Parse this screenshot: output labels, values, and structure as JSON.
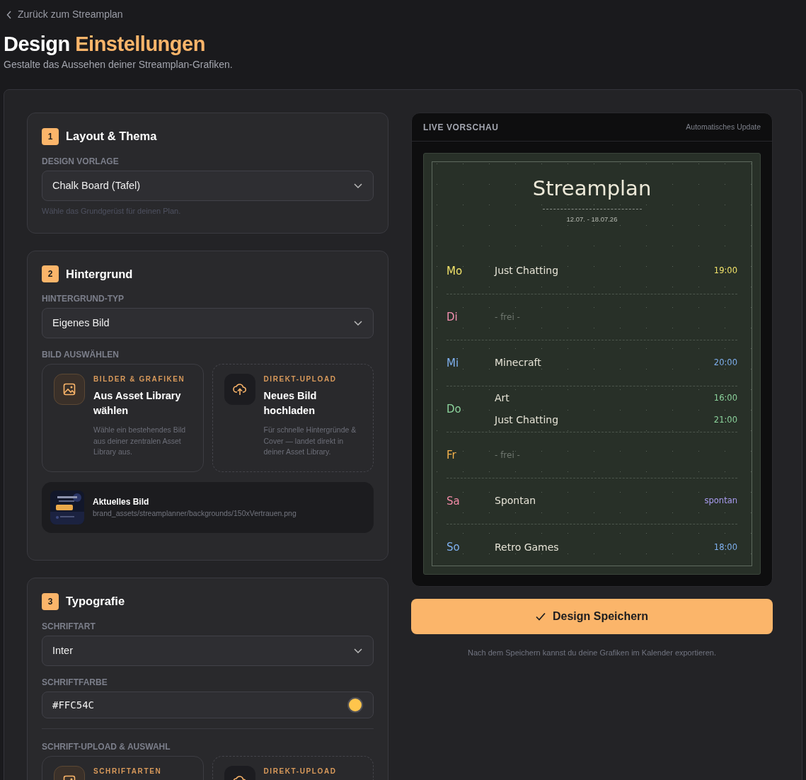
{
  "back_link": "Zurück zum Streamplan",
  "title": {
    "main": "Design",
    "accent": "Einstellungen"
  },
  "subtitle": "Gestalte das Aussehen deiner Streamplan-Grafiken.",
  "sections": [
    {
      "number": "1",
      "title": "Layout & Thema",
      "fields": [
        {
          "kind": "select",
          "label": "DESIGN VORLAGE",
          "value": "Chalk Board (Tafel)",
          "hint": "Wähle das Grundgerüst für deinen Plan."
        }
      ]
    },
    {
      "number": "2",
      "title": "Hintergrund",
      "fields": [
        {
          "kind": "select",
          "label": "HINTERGRUND-TYP",
          "value": "Eigenes Bild"
        },
        {
          "kind": "options",
          "label": "BILD AUSWÄHLEN",
          "options": [
            {
              "kind": "library",
              "eyebrow": "BILDER & GRAFIKEN",
              "title": "Aus Asset Library wählen",
              "text": "Wähle ein bestehendes Bild aus deiner zentralen Asset Library aus."
            },
            {
              "kind": "upload",
              "eyebrow": "DIREKT-UPLOAD",
              "title": "Neues Bild hochladen",
              "text": "Für schnelle Hintergründe & Cover — landet direkt in deiner Asset Library."
            }
          ]
        },
        {
          "kind": "current",
          "title": "Aktuelles Bild",
          "path": "brand_assets/streamplanner/backgrounds/150xVertrauen.png"
        }
      ]
    },
    {
      "number": "3",
      "title": "Typografie",
      "fields": [
        {
          "kind": "select",
          "label": "SCHRIFTART",
          "value": "Inter"
        },
        {
          "kind": "color",
          "label": "SCHRIFTFARBE",
          "value": "#FFC54C",
          "color": "#ffc54c"
        },
        {
          "kind": "divider"
        },
        {
          "kind": "options",
          "label": "SCHRIFT-UPLOAD & AUSWAHL",
          "options": [
            {
              "kind": "library",
              "eyebrow": "SCHRIFTARTEN"
            },
            {
              "kind": "upload",
              "eyebrow": "DIREKT-UPLOAD"
            }
          ]
        }
      ]
    }
  ],
  "preview": {
    "header": "LIVE VORSCHAU",
    "status": "Automatisches Update",
    "plan_title": "Streamplan",
    "date_range": "12.07. - 18.07.26",
    "days": [
      {
        "day": "Mo",
        "color": "#f2e36a",
        "slots": [
          {
            "kind": "stream",
            "title": "Just Chatting",
            "time": "19:00",
            "color": "#f2e36a"
          }
        ]
      },
      {
        "day": "Di",
        "color": "#f28fb0",
        "slots": [
          {
            "kind": "free",
            "title": "- frei -"
          }
        ]
      },
      {
        "day": "Mi",
        "color": "#7fb0ef",
        "slots": [
          {
            "kind": "stream",
            "title": "Minecraft",
            "time": "20:00",
            "color": "#7fb0ef"
          }
        ]
      },
      {
        "day": "Do",
        "color": "#8cd39c",
        "slots": [
          {
            "kind": "stream",
            "title": "Art",
            "time": "16:00",
            "color": "#8cd39c"
          },
          {
            "kind": "stream",
            "title": "Just Chatting",
            "time": "21:00",
            "color": "#8cd39c"
          }
        ]
      },
      {
        "day": "Fr",
        "color": "#f5b14c",
        "slots": [
          {
            "kind": "free",
            "title": "- frei -"
          }
        ]
      },
      {
        "day": "Sa",
        "color": "#f08aa6",
        "slots": [
          {
            "kind": "stream",
            "title": "Spontan",
            "time": "spontan",
            "color": "#a99cf0"
          }
        ]
      },
      {
        "day": "So",
        "color": "#7fb0ef",
        "slots": [
          {
            "kind": "stream",
            "title": "Retro Games",
            "time": "18:00",
            "color": "#7fb0ef"
          }
        ]
      }
    ]
  },
  "save_button": "Design Speichern",
  "save_note": "Nach dem Speichern kannst du deine Grafiken im Kalender exportieren."
}
